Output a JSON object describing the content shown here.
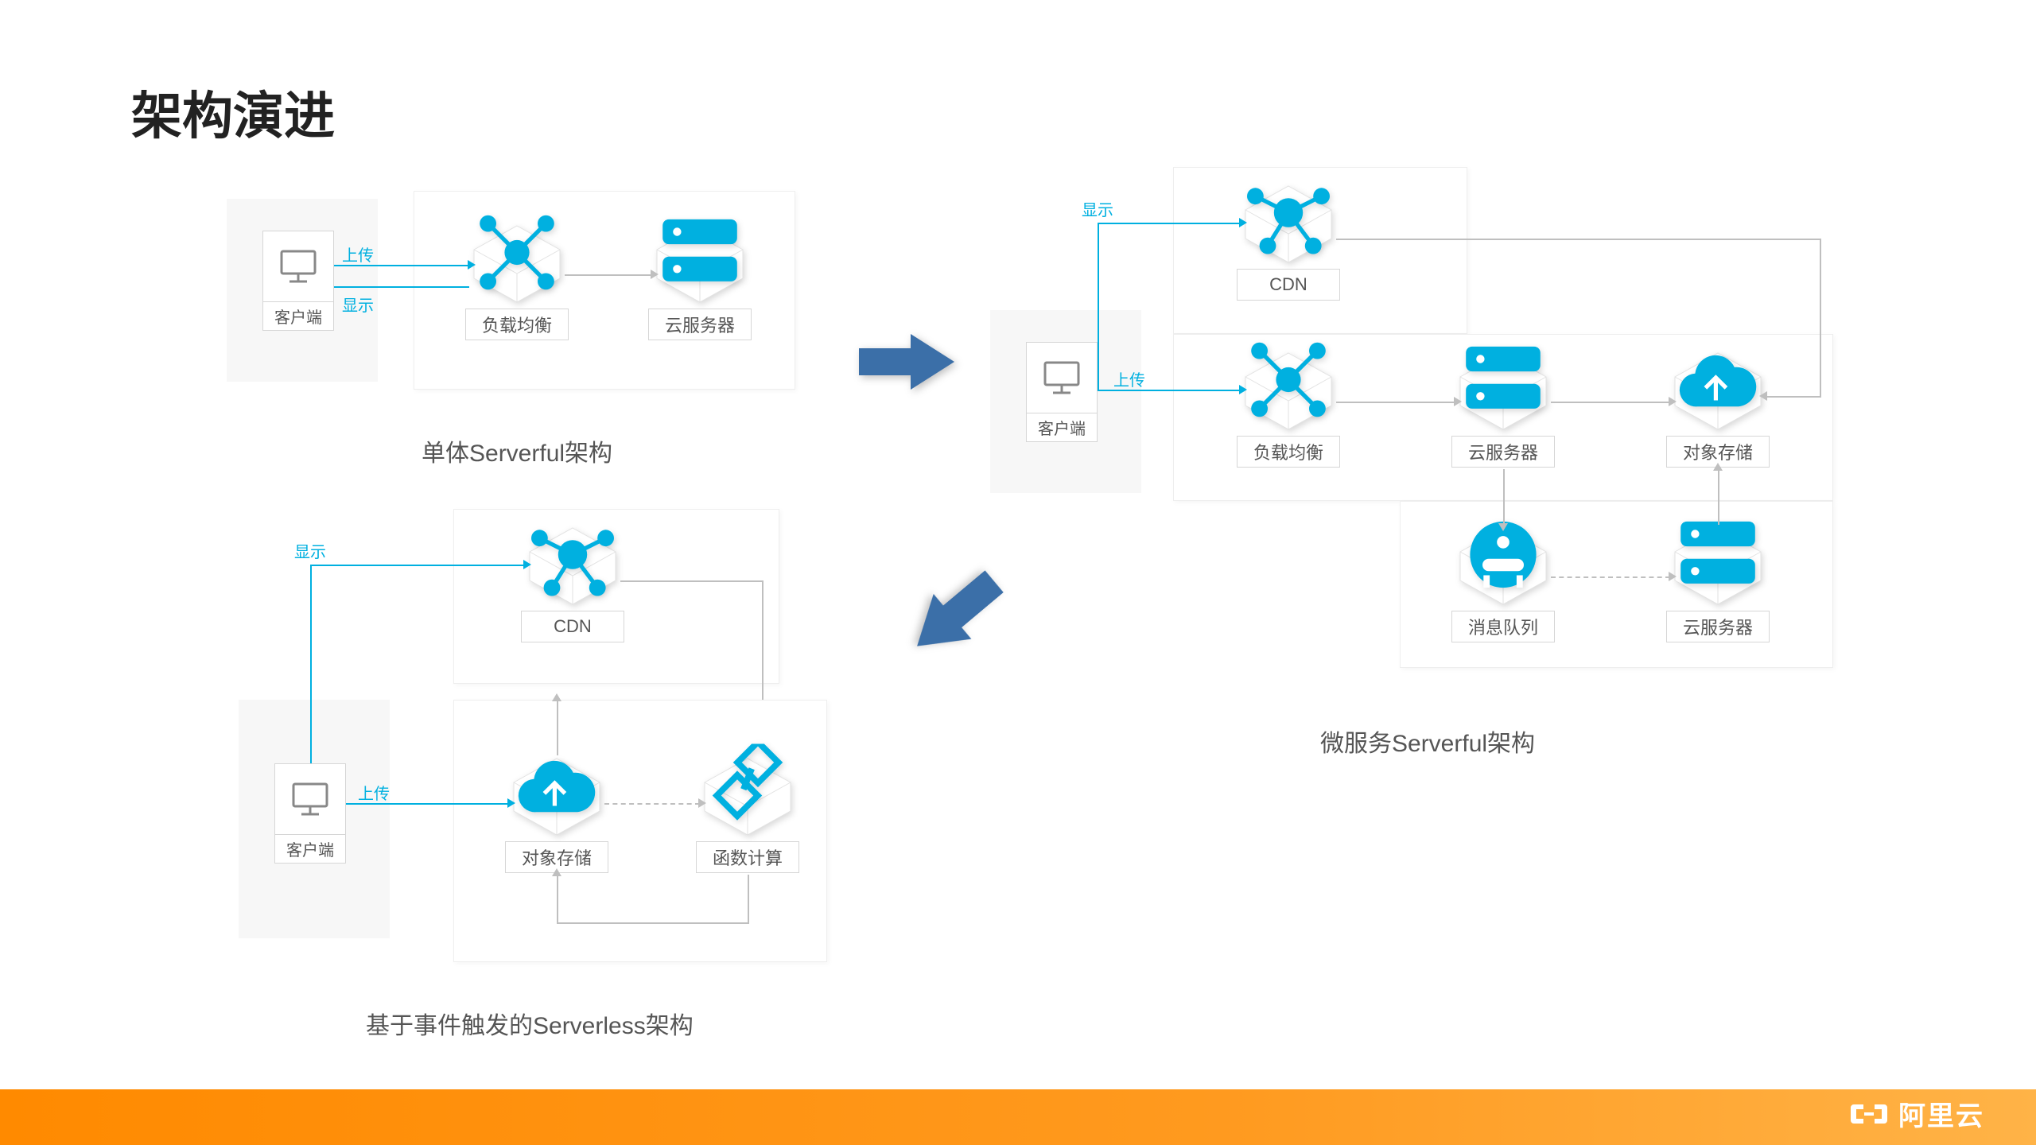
{
  "title": "架构演进",
  "brand": "阿里云",
  "labels": {
    "client": "客户端",
    "lb": "负载均衡",
    "ecs": "云服务器",
    "cdn": "CDN",
    "oss": "对象存储",
    "fc": "函数计算",
    "mq": "消息队列",
    "upload": "上传",
    "display": "显示"
  },
  "subtitles": {
    "monolith": "单体Serverful架构",
    "microservice": "微服务Serverful架构",
    "serverless": "基于事件触发的Serverless架构"
  }
}
